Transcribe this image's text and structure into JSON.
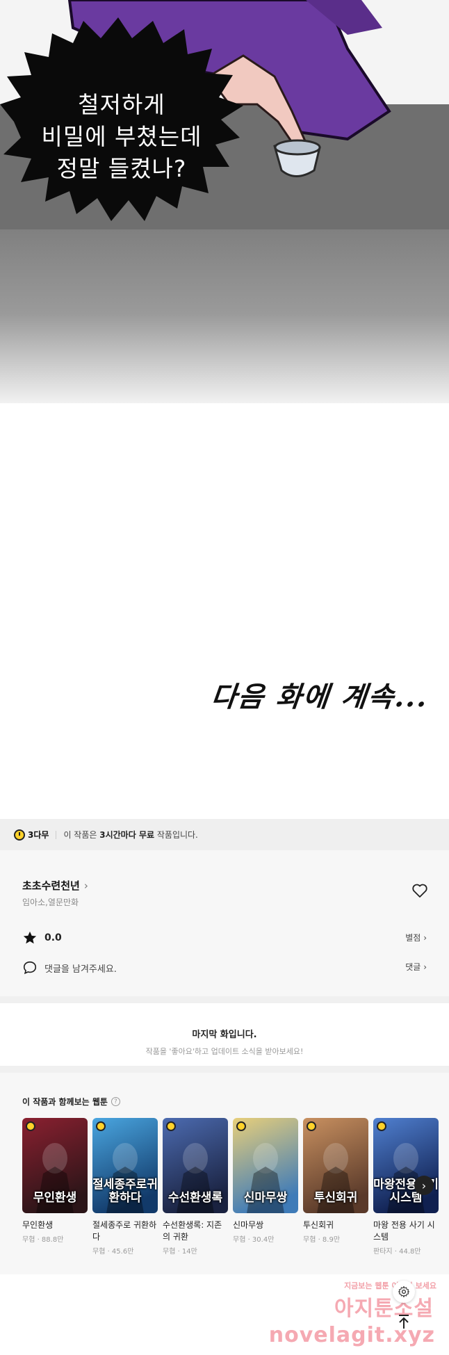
{
  "comic": {
    "bubble_lines": [
      "철저하게",
      "비밀에 부쳤는데",
      "정말 들켰나?"
    ],
    "next_text": "다음 화에 계속..."
  },
  "free_banner": {
    "badge": "3다무",
    "prefix": "이 작품은",
    "bold": "3시간마다 무료",
    "suffix": "작품입니다."
  },
  "work": {
    "title": "초초수련천년",
    "authors": "임아소,열문만화",
    "rating": "0.0",
    "rate_link": "별점",
    "comment_placeholder": "댓글을 남겨주세요.",
    "comment_link": "댓글"
  },
  "last_episode": {
    "title": "마지막 화입니다.",
    "subtitle": "작품을 '좋아요'하고 업데이트 소식을 받아보세요!"
  },
  "recommendations": {
    "heading": "이 작품과 함께보는 웹툰",
    "items": [
      {
        "name": "무인환생",
        "meta": "무협 · 88.8만",
        "cover_text": "무인환생",
        "color_a": "#2b1518",
        "color_b": "#8a2030"
      },
      {
        "name": "절세종주로 귀환하다",
        "meta": "무협 · 45.6만",
        "cover_text": "절세종주로귀환하다",
        "color_a": "#123a6a",
        "color_b": "#4aa6e0"
      },
      {
        "name": "수선환생록: 지존의 귀환",
        "meta": "무협 · 14만",
        "cover_text": "수선환생록",
        "color_a": "#1a2240",
        "color_b": "#4c6bb0"
      },
      {
        "name": "신마무쌍",
        "meta": "무협 · 30.4만",
        "cover_text": "신마무쌍",
        "color_a": "#3f7bb8",
        "color_b": "#e8cf7a"
      },
      {
        "name": "투신회귀",
        "meta": "무협 · 8.9만",
        "cover_text": "투신회귀",
        "color_a": "#5a3a2a",
        "color_b": "#c89060"
      },
      {
        "name": "마왕 전용 사기 시스템",
        "meta": "판타지 · 44.8만",
        "cover_text": "마왕전용사기시스템",
        "color_a": "#102050",
        "color_b": "#5080d0"
      }
    ]
  },
  "watermark": {
    "small": "지금보는 웹툰 여기서 보세요",
    "big": "아지툰소설",
    "url": "novelagit.xyz"
  },
  "colors": {
    "accent_yellow": "#ffd22a",
    "robe_purple": "#6a3aa0",
    "watermark_pink": "#f4a0aa"
  }
}
